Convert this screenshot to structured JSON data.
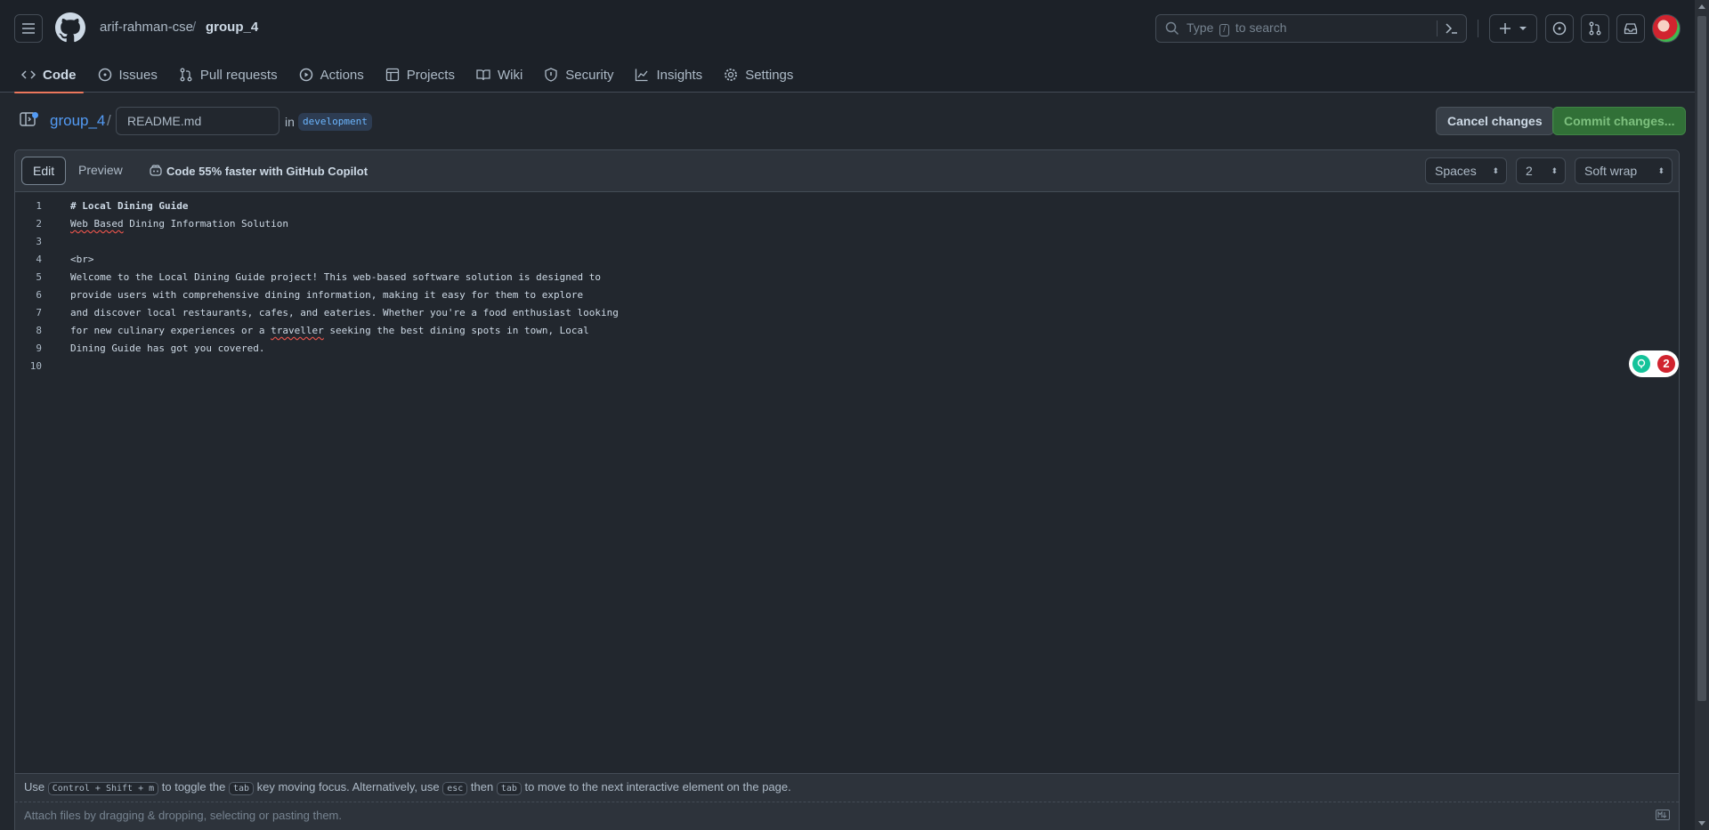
{
  "header": {
    "owner": "arif-rahman-cse",
    "separator": "/",
    "repo": "group_4",
    "search": {
      "prefix": "Type",
      "key": "/",
      "suffix": "to search"
    }
  },
  "nav": {
    "tabs": [
      {
        "label": "Code",
        "icon": "code-icon",
        "active": true
      },
      {
        "label": "Issues",
        "icon": "issue-icon"
      },
      {
        "label": "Pull requests",
        "icon": "pull-request-icon"
      },
      {
        "label": "Actions",
        "icon": "play-icon"
      },
      {
        "label": "Projects",
        "icon": "table-icon"
      },
      {
        "label": "Wiki",
        "icon": "book-icon"
      },
      {
        "label": "Security",
        "icon": "shield-icon"
      },
      {
        "label": "Insights",
        "icon": "graph-icon"
      },
      {
        "label": "Settings",
        "icon": "gear-icon"
      }
    ]
  },
  "file": {
    "repo_link": "group_4",
    "path_separator": "/",
    "filename": "README.md",
    "in_label": "in",
    "branch": "development",
    "cancel_label": "Cancel changes",
    "commit_label": "Commit changes..."
  },
  "editor": {
    "edit_tab": "Edit",
    "preview_tab": "Preview",
    "copilot_text": "Code 55% faster with GitHub Copilot",
    "indent_mode": "Spaces",
    "indent_size": "2",
    "wrap_mode": "Soft wrap",
    "lines": [
      {
        "n": "1",
        "text": "# Local Dining Guide"
      },
      {
        "n": "2",
        "squiggle": "Web Based",
        "text": " Dining Information Solution"
      },
      {
        "n": "3",
        "text": ""
      },
      {
        "n": "4",
        "text": "<br>"
      },
      {
        "n": "5",
        "text": "Welcome to the Local Dining Guide project! This web-based software solution is designed to"
      },
      {
        "n": "6",
        "text": "provide users with comprehensive dining information, making it easy for them to explore"
      },
      {
        "n": "7",
        "text": "and discover local restaurants, cafes, and eateries. Whether you're a food enthusiast looking"
      },
      {
        "n": "8",
        "pre": "for new culinary experiences or a ",
        "squiggle": "traveller",
        "text": " seeking the best dining spots in town, Local"
      },
      {
        "n": "9",
        "text": "Dining Guide has got you covered."
      },
      {
        "n": "10",
        "text": ""
      }
    ],
    "grammar_count": "2",
    "footer": {
      "use": "Use",
      "kbd_toggle": "Control + Shift + m",
      "t1": "to toggle the",
      "kbd_tab": "tab",
      "t2": "key moving focus. Alternatively, use",
      "kbd_esc": "esc",
      "then": "then",
      "kbd_tab2": "tab",
      "t3": "to move to the next interactive element on the page."
    },
    "attach_text": "Attach files by dragging & dropping, selecting or pasting them."
  },
  "colors": {
    "accent_link": "#539bf5",
    "active_tab_underline": "#ec775c",
    "commit_green": "#347d39",
    "squiggle_red": "#e5534b"
  }
}
